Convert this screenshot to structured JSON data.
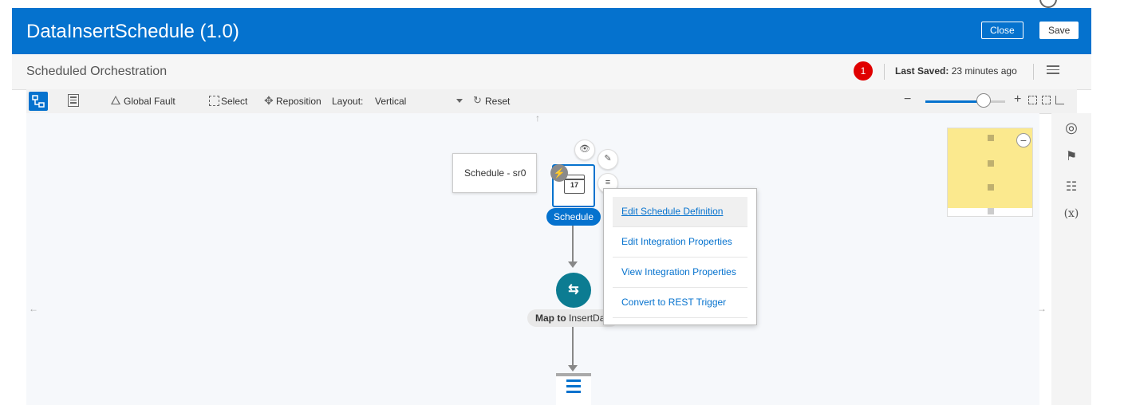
{
  "header": {
    "title": "DataInsertSchedule (1.0)",
    "close_label": "Close",
    "save_label": "Save"
  },
  "subheader": {
    "title": "Scheduled Orchestration",
    "error_count": "1",
    "last_saved_label": "Last Saved:",
    "last_saved_value": "23 minutes ago"
  },
  "toolbar": {
    "global_fault_label": "Global Fault",
    "select_label": "Select",
    "reposition_label": "Reposition",
    "layout_label": "Layout:",
    "layout_value": "Vertical",
    "reset_label": "Reset",
    "zoom_level": 0.73
  },
  "canvas": {
    "tooltip_text": "Schedule - sr0",
    "schedule_label": "Schedule",
    "calendar_day": "17",
    "map_label_prefix": "Map to",
    "map_label_target": "InsertDa"
  },
  "context_menu": {
    "items": [
      {
        "label": "Edit Schedule Definition"
      },
      {
        "label": "Edit Integration Properties"
      },
      {
        "label": "View Integration Properties"
      },
      {
        "label": "Convert to REST Trigger"
      }
    ]
  },
  "side_panel": {
    "variables_label": "(x)"
  },
  "colors": {
    "brand": "#0572ce",
    "map_node": "#0c7c92",
    "error_badge": "#e00000",
    "minimap": "#fbe98e"
  }
}
